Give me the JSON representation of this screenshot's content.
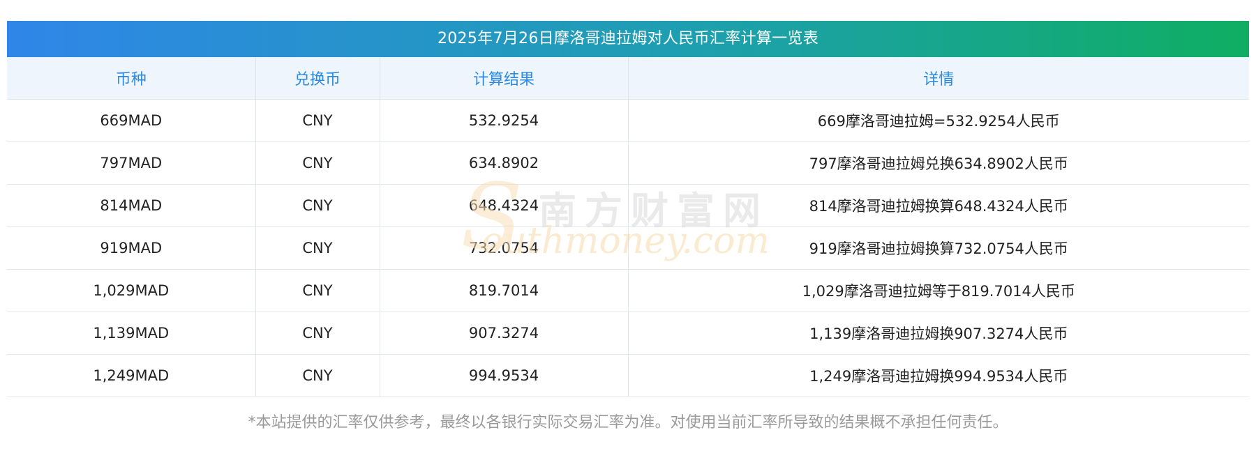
{
  "title": "2025年7月26日摩洛哥迪拉姆对人民币汇率计算一览表",
  "columns": [
    "币种",
    "兑换币",
    "计算结果",
    "详情"
  ],
  "rows": [
    {
      "currency": "669MAD",
      "target": "CNY",
      "result": "532.9254",
      "detail": "669摩洛哥迪拉姆=532.9254人民币"
    },
    {
      "currency": "797MAD",
      "target": "CNY",
      "result": "634.8902",
      "detail": "797摩洛哥迪拉姆兑换634.8902人民币"
    },
    {
      "currency": "814MAD",
      "target": "CNY",
      "result": "648.4324",
      "detail": "814摩洛哥迪拉姆换算648.4324人民币"
    },
    {
      "currency": "919MAD",
      "target": "CNY",
      "result": "732.0754",
      "detail": "919摩洛哥迪拉姆换算732.0754人民币"
    },
    {
      "currency": "1,029MAD",
      "target": "CNY",
      "result": "819.7014",
      "detail": "1,029摩洛哥迪拉姆等于819.7014人民币"
    },
    {
      "currency": "1,139MAD",
      "target": "CNY",
      "result": "907.3274",
      "detail": "1,139摩洛哥迪拉姆换907.3274人民币"
    },
    {
      "currency": "1,249MAD",
      "target": "CNY",
      "result": "994.9534",
      "detail": "1,249摩洛哥迪拉姆换994.9534人民币"
    }
  ],
  "watermark": {
    "line1": "南方财富网",
    "line2": "outhmoney.com",
    "s_letter": "S"
  },
  "footer": "*本站提供的汇率仅供参考，最终以各银行实际交易汇率为准。对使用当前汇率所导致的结果概不承担任何责任。",
  "colors": {
    "title_gradient_start": "#2f86e8",
    "title_gradient_end": "#0fae62",
    "header_text": "#2b8ae0",
    "header_bg": "#eef5fd",
    "footer_text": "#9a9a9a"
  }
}
